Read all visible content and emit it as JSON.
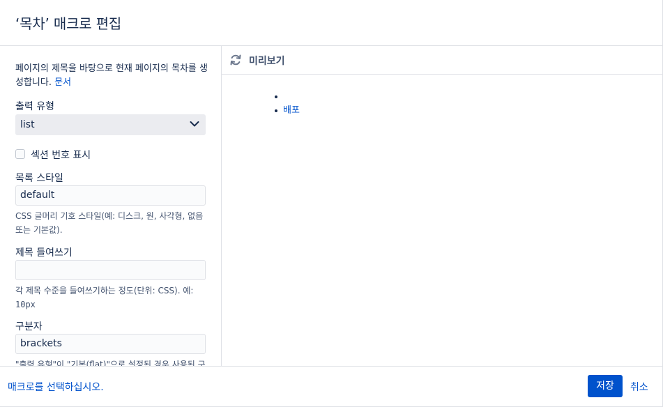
{
  "header": {
    "title": "‘목차’ 매크로 편집"
  },
  "left": {
    "description": "페이지의 제목을 바탕으로 현재 페이지의 목차를 생성합니다.",
    "doc_link": "문서",
    "output_type": {
      "label": "출력 유형",
      "value": "list"
    },
    "section_numbers": {
      "label": "섹션 번호 표시",
      "checked": false
    },
    "list_style": {
      "label": "목록 스타일",
      "value": "default",
      "help": "CSS 글머리 기호 스타일(예: 디스크, 원, 사각형, 없음 또는 기본값)."
    },
    "heading_indent": {
      "label": "제목 들여쓰기",
      "value": "",
      "help_prefix": "각 제목 수준을 들여쓰기하는 정도(단위: CSS). 예: ",
      "help_code": "10px"
    },
    "separator": {
      "label": "구분자",
      "value": "brackets",
      "help": "\"출력 유형\"이 \"기본(flat)\"으로 설정된 경우 사용된 구"
    }
  },
  "preview": {
    "title": "미리보기",
    "items": [
      "",
      "배포"
    ]
  },
  "footer": {
    "select_macro_link": "매크로를 선택하십시오.",
    "save_label": "저장",
    "cancel_label": "취소"
  },
  "colors": {
    "accent": "#0052cc",
    "text": "#172b4d",
    "border": "#dfe1e6"
  }
}
